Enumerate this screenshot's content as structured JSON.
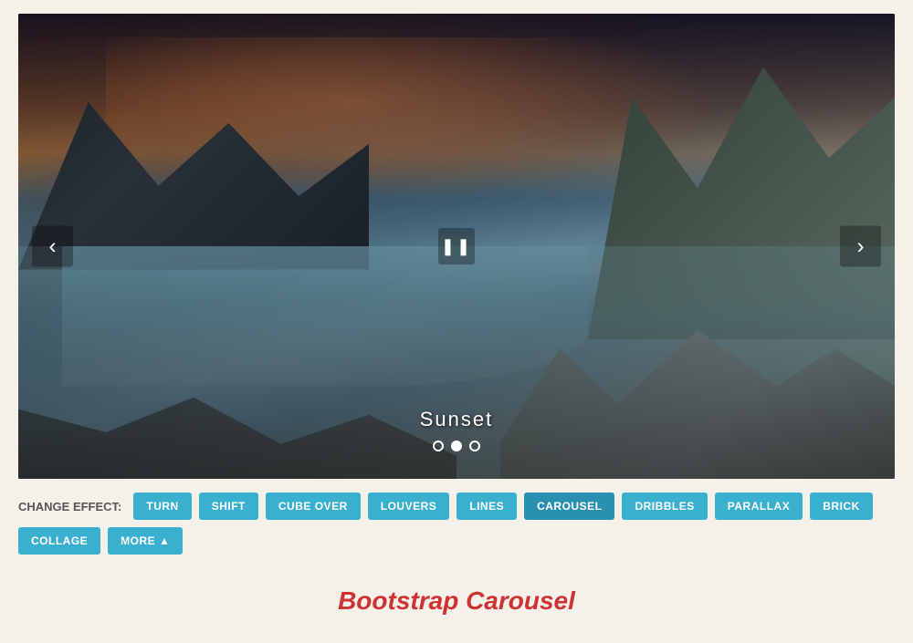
{
  "carousel": {
    "current_slide": 2,
    "total_slides": 3,
    "caption": "Sunset",
    "prev_label": "‹",
    "next_label": "›",
    "pause_label": "❚❚"
  },
  "controls": {
    "label": "CHANGE EFFECT:",
    "buttons": [
      {
        "id": "turn",
        "label": "TURN"
      },
      {
        "id": "shift",
        "label": "SHIFT"
      },
      {
        "id": "cube-over",
        "label": "CUBE OVER"
      },
      {
        "id": "louvers",
        "label": "LOUVERS"
      },
      {
        "id": "lines",
        "label": "LINES"
      },
      {
        "id": "carousel",
        "label": "CAROUSEL"
      },
      {
        "id": "dribbles",
        "label": "DRIBBLES"
      },
      {
        "id": "parallax",
        "label": "PARALLAX"
      },
      {
        "id": "brick",
        "label": "BRICK"
      },
      {
        "id": "collage",
        "label": "COLLAGE"
      },
      {
        "id": "more",
        "label": "MORE ▲"
      }
    ]
  },
  "page": {
    "title": "Bootstrap Carousel"
  }
}
